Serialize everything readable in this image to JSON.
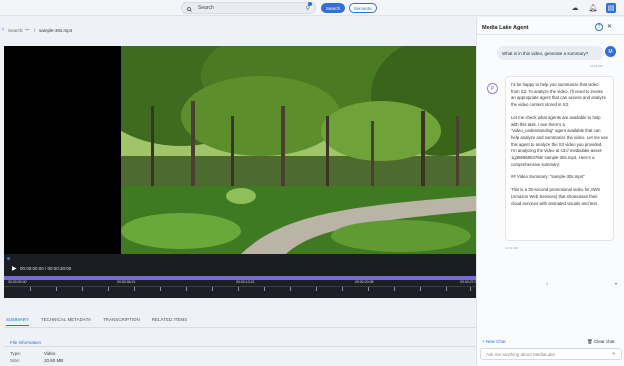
{
  "search": {
    "placeholder": "Search",
    "search_label": "Search",
    "semantic_label": "Semantic"
  },
  "breadcrumb": {
    "root": "Search: \"*\"",
    "separator": "/",
    "current": "sample-30s.mp4"
  },
  "player": {
    "time": "00:00:00:00 / 00:00:30:00"
  },
  "timeline": {
    "labels": [
      "00:00:00:00",
      "00:00:06:21",
      "00:00:13:21",
      "00:00:20:08",
      "00:00:27:03"
    ]
  },
  "tabs": [
    "SUMMARY",
    "TECHNICAL METADATA",
    "TRANSCRIPTION",
    "RELATED ITEMS"
  ],
  "file_info": {
    "heading": "File Information",
    "type_key": "Type:",
    "type_val": "Video",
    "size_key": "Size:",
    "size_val": "20.60 MB"
  },
  "panel": {
    "title": "Media Lake Agent",
    "user_message": "What is in this video, generate a summary?",
    "user_initial": "M",
    "user_time": "11:12 AM",
    "bot_initial": "P",
    "bot_paragraphs": [
      "I'd be happy to help you summarize that video from S3. To analyze the video, I'll need to invoke an appropriate agent that can access and analyze the video content stored in S3.",
      "Let me check what agents are available to help with this task. I see there's a \"video_understanding\" agent available that can help analyze and summarize the video. Let me use this agent to analyze the S3 video you provided. I'm analyzing the video at s3:// medialake-asset-1g38686953766/ sample-30s.mp4. Here's a comprehensive summary:",
      "## Video Summary: \"sample-30s.mp4\"",
      "This is a 30-second promotional video for AWS (Amazon Web Services) that showcases their cloud services with animated visuals and text."
    ],
    "bot_time": "11:13 AM",
    "mid_marker": "0",
    "new_chat": "New Chat",
    "clear_chat": "Clear chat",
    "input_placeholder": "Ask me anything about MediaLake"
  }
}
